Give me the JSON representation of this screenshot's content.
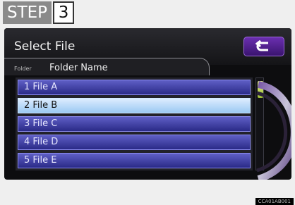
{
  "step": {
    "word": "STEP",
    "number": "3"
  },
  "screen": {
    "title": "Select File",
    "folder_label": "Folder",
    "folder_name": "Folder Name"
  },
  "files": [
    "1  File A",
    "2  File B",
    "3  File C",
    "4  File D",
    "5  File E"
  ],
  "selected_index": 1,
  "icons": {
    "back": "back-arrow-icon"
  },
  "footer": {
    "code": "CCA01AB001"
  },
  "colors": {
    "accent_purple": "#6b2fb0",
    "selected_row": "#b9dcff",
    "list_item": "#3c3ca8"
  }
}
